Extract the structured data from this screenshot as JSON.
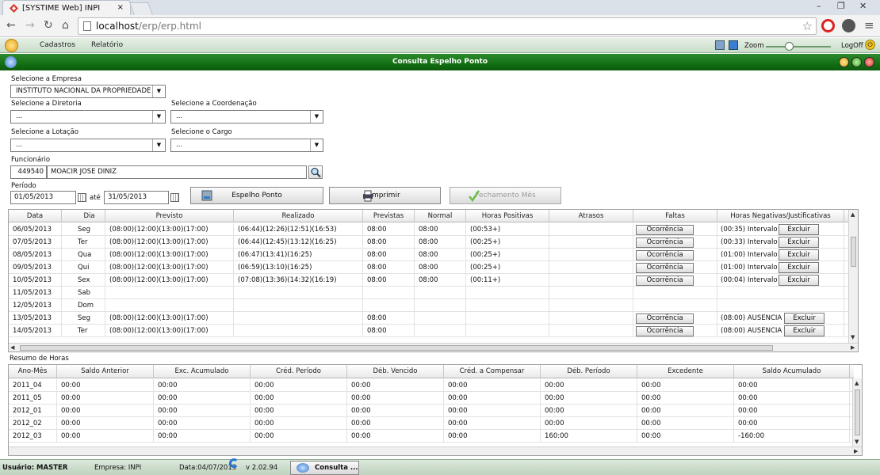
{
  "browser": {
    "tab_title": "[SYSTIME Web] INPI",
    "tab_close": "×",
    "url_host": "localhost",
    "url_path": "/erp/erp.html",
    "win_minimize": "–",
    "win_restore": "❐",
    "win_close": "✕"
  },
  "menubar": {
    "items": [
      "Cadastros",
      "Relatório"
    ],
    "zoom_label": "Zoom",
    "zoom_level": 0.35,
    "logoff_label": "LogOff"
  },
  "window": {
    "title": "Consulta Espelho Ponto"
  },
  "form": {
    "empresa_label": "Selecione a Empresa",
    "empresa_value": "INSTITUTO NACIONAL DA PROPRIEDADE",
    "diretoria_label": "Selecione a Diretoria",
    "diretoria_value": "...",
    "coordenacao_label": "Selecione a Coordenação",
    "coordenacao_value": "...",
    "lotacao_label": "Selecione a Lotação",
    "lotacao_value": "...",
    "cargo_label": "Selecione o Cargo",
    "cargo_value": "...",
    "funcionario_label": "Funcionário",
    "funcionario_id": "449540",
    "funcionario_nome": "MOACIR JOSE DINIZ",
    "periodo_label": "Período",
    "data_inicio": "01/05/2013",
    "ate_label": "até",
    "data_fim": "31/05/2013",
    "btn_espelho": "Espelho Ponto",
    "btn_imprimir": "Imprimir",
    "btn_fechamento": "Fechamento Mês"
  },
  "grid1": {
    "headers": [
      "Data",
      "Dia",
      "Previsto",
      "Realizado",
      "Previstas",
      "Normal",
      "Horas Positivas",
      "Atrasos",
      "Faltas",
      "Horas Negativas/Justificativas"
    ],
    "occ_label": "Ocorrência",
    "exc_label": "Excluir",
    "rows": [
      {
        "data": "06/05/2013",
        "dia": "Seg",
        "previsto": "(08:00)(12:00)(13:00)(17:00)",
        "realizado": "(06:44)(12:26)(12:51)(16:53)",
        "previstas": "08:00",
        "normal": "08:00",
        "positivas": "(00:53+)",
        "atrasos": "",
        "neg": "(00:35) Intervalo"
      },
      {
        "data": "07/05/2013",
        "dia": "Ter",
        "previsto": "(08:00)(12:00)(13:00)(17:00)",
        "realizado": "(06:44)(12:45)(13:12)(16:25)",
        "previstas": "08:00",
        "normal": "08:00",
        "positivas": "(00:25+)",
        "atrasos": "",
        "neg": "(00:33) Intervalo"
      },
      {
        "data": "08/05/2013",
        "dia": "Qua",
        "previsto": "(08:00)(12:00)(13:00)(17:00)",
        "realizado": "(06:47)(13:41)(16:25)",
        "previstas": "08:00",
        "normal": "08:00",
        "positivas": "(00:25+)",
        "atrasos": "",
        "neg": "(01:00) Intervalo"
      },
      {
        "data": "09/05/2013",
        "dia": "Qui",
        "previsto": "(08:00)(12:00)(13:00)(17:00)",
        "realizado": "(06:59)(13:10)(16:25)",
        "previstas": "08:00",
        "normal": "08:00",
        "positivas": "(00:25+)",
        "atrasos": "",
        "neg": "(01:00) Intervalo"
      },
      {
        "data": "10/05/2013",
        "dia": "Sex",
        "previsto": "(08:00)(12:00)(13:00)(17:00)",
        "realizado": "(07:08)(13:36)(14:32)(16:19)",
        "previstas": "08:00",
        "normal": "08:00",
        "positivas": "(00:11+)",
        "atrasos": "",
        "neg": "(00:04) Intervalo"
      },
      {
        "data": "11/05/2013",
        "dia": "Sab",
        "previsto": "",
        "realizado": "",
        "previstas": "",
        "normal": "",
        "positivas": "",
        "atrasos": "",
        "neg": ""
      },
      {
        "data": "12/05/2013",
        "dia": "Dom",
        "previsto": "",
        "realizado": "",
        "previstas": "",
        "normal": "",
        "positivas": "",
        "atrasos": "",
        "neg": ""
      },
      {
        "data": "13/05/2013",
        "dia": "Seg",
        "previsto": "(08:00)(12:00)(13:00)(17:00)",
        "realizado": "",
        "previstas": "08:00",
        "normal": "",
        "positivas": "",
        "atrasos": "",
        "neg": "(08:00) AUSENCIA"
      },
      {
        "data": "14/05/2013",
        "dia": "Ter",
        "previsto": "(08:00)(12:00)(13:00)(17:00)",
        "realizado": "",
        "previstas": "08:00",
        "normal": "",
        "positivas": "",
        "atrasos": "",
        "neg": "(08:00) AUSENCIA"
      }
    ]
  },
  "resumo": {
    "label": "Resumo de Horas",
    "headers": [
      "Ano-Mês",
      "Saldo Anterior",
      "Exc. Acumulado",
      "Créd. Período",
      "Déb. Vencido",
      "Créd. a Compensar",
      "Déb. Período",
      "Excedente",
      "Saldo Acumulado"
    ],
    "rows": [
      [
        "2011_04",
        "00:00",
        "00:00",
        "00:00",
        "00:00",
        "00:00",
        "00:00",
        "00:00",
        "00:00"
      ],
      [
        "2011_05",
        "00:00",
        "00:00",
        "00:00",
        "00:00",
        "00:00",
        "00:00",
        "00:00",
        "00:00"
      ],
      [
        "2012_01",
        "00:00",
        "00:00",
        "00:00",
        "00:00",
        "00:00",
        "00:00",
        "00:00",
        "00:00"
      ],
      [
        "2012_02",
        "00:00",
        "00:00",
        "00:00",
        "00:00",
        "00:00",
        "00:00",
        "00:00",
        "00:00"
      ],
      [
        "2012_03",
        "00:00",
        "00:00",
        "00:00",
        "00:00",
        "00:00",
        "160:00",
        "00:00",
        "-160:00"
      ]
    ]
  },
  "status": {
    "usuario": "Usuário: MASTER",
    "empresa": "Empresa: INPI",
    "data": "Data:04/07/2013",
    "versao": "v 2.02.94",
    "task": "Consulta ..."
  }
}
